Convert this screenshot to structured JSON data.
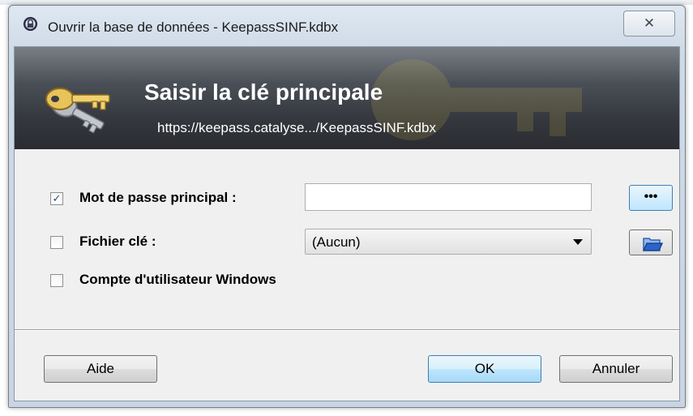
{
  "window": {
    "title": "Ouvrir la base de données - KeepassSINF.kdbx",
    "close_glyph": "✕"
  },
  "banner": {
    "title": "Saisir la clé principale",
    "subtitle": "https://keepass.catalyse.../KeepassSINF.kdbx"
  },
  "form": {
    "master_password": {
      "checked": true,
      "check_glyph": "✓",
      "label": "Mot de passe principal :",
      "value": "",
      "reveal_button_label": "•••"
    },
    "key_file": {
      "checked": false,
      "label": "Fichier clé :",
      "selected": "(Aucun)"
    },
    "windows_account": {
      "checked": false,
      "label": "Compte d'utilisateur Windows"
    }
  },
  "buttons": {
    "help": "Aide",
    "ok": "OK",
    "cancel": "Annuler"
  },
  "colors": {
    "banner_dark": "#2a2c31",
    "default_button_border": "#3c7fb1",
    "folder_blue": "#2b63c9"
  }
}
